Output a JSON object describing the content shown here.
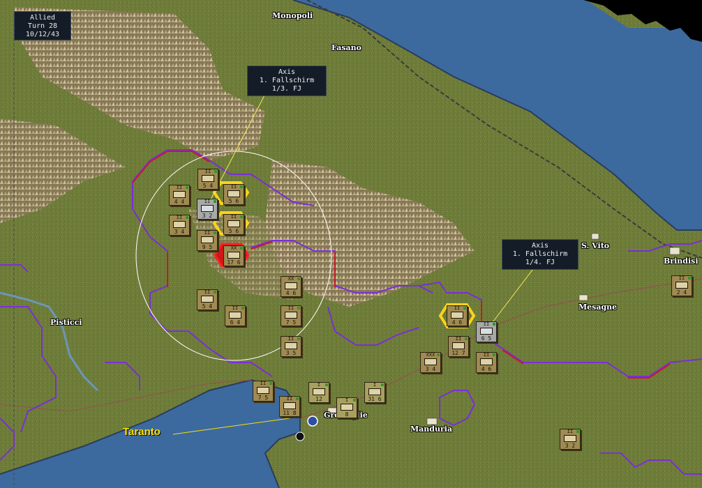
{
  "turn_box": {
    "side": "Allied",
    "turn": "Turn 28",
    "date": "10/12/43"
  },
  "tooltips": [
    {
      "side": "Axis",
      "division": "1. Fallschirm",
      "unit": "1/3. FJ"
    },
    {
      "side": "Axis",
      "division": "1. Fallschirm",
      "unit": "1/4. FJ"
    }
  ],
  "places": [
    {
      "name": "Monopoli"
    },
    {
      "name": "Fasano"
    },
    {
      "name": "Pisticci"
    },
    {
      "name": "S. Vito"
    },
    {
      "name": "Brindisi"
    },
    {
      "name": "Mesagne"
    },
    {
      "name": "Manduria"
    },
    {
      "name": "Grottaglie"
    }
  ],
  "highlight_city": {
    "name": "Taranto",
    "color": "#ffe000"
  },
  "colors": {
    "sea": "#3c6a9e",
    "land": "#6f7d3a",
    "axis_border": "#7a2fd6",
    "frontline": "#c21c2a",
    "selected_hex": "#ffd21c",
    "attack_hex": "#ff2020"
  },
  "units": [
    {
      "id": "u1",
      "size": "II",
      "type": "infantry",
      "val": "5 4",
      "side": "allied"
    },
    {
      "id": "u2",
      "size": "II",
      "type": "infantry",
      "val": "4 4",
      "side": "allied"
    },
    {
      "id": "u3",
      "size": "II",
      "type": "infantry",
      "val": "3 2",
      "side": "axis"
    },
    {
      "id": "u4",
      "size": "II",
      "type": "infantry",
      "val": "3 4",
      "side": "allied"
    },
    {
      "id": "u5",
      "size": "II",
      "type": "infantry",
      "val": "5 6",
      "side": "allied"
    },
    {
      "id": "u6",
      "size": "II",
      "type": "infantry",
      "val": "5 6",
      "side": "allied"
    },
    {
      "id": "u7",
      "size": "II",
      "type": "armor",
      "val": "9 5",
      "side": "allied"
    },
    {
      "id": "u8",
      "size": "XX",
      "type": "HQ",
      "val": "17 6",
      "side": "allied"
    },
    {
      "id": "u9",
      "size": "XX",
      "type": "HQ",
      "val": "4 6",
      "side": "allied"
    },
    {
      "id": "u10",
      "size": "II",
      "type": "recon",
      "val": "5 4",
      "side": "allied"
    },
    {
      "id": "u11",
      "size": "II",
      "type": "recon",
      "val": "6 4",
      "side": "allied"
    },
    {
      "id": "u12",
      "size": "II",
      "type": "recon",
      "val": "7 5",
      "side": "allied"
    },
    {
      "id": "u13",
      "size": "II",
      "type": "engineer",
      "val": "3 5",
      "side": "allied"
    },
    {
      "id": "u14",
      "size": "II",
      "type": "armor",
      "val": "4 6",
      "side": "allied"
    },
    {
      "id": "u15",
      "size": "II",
      "type": "infantry",
      "val": "6 5",
      "side": "axis"
    },
    {
      "id": "u16",
      "size": "II",
      "type": "armor",
      "val": "12 7",
      "side": "allied"
    },
    {
      "id": "u17",
      "size": "XXX",
      "type": "HQ",
      "val": "3 4",
      "side": "allied"
    },
    {
      "id": "u18",
      "size": "II",
      "type": "armor",
      "val": "4 6",
      "side": "allied"
    },
    {
      "id": "u19",
      "size": "II",
      "type": "infantry",
      "val": "2 4",
      "side": "allied"
    },
    {
      "id": "u20",
      "size": "II",
      "type": "recon",
      "val": "7 5",
      "side": "allied"
    },
    {
      "id": "u21",
      "size": "II",
      "type": "armor",
      "val": "11 8",
      "side": "allied"
    },
    {
      "id": "u22",
      "size": "I",
      "type": "air",
      "val": "12",
      "side": "allied"
    },
    {
      "id": "u23",
      "size": "I",
      "type": "air",
      "val": "31 6",
      "side": "allied"
    },
    {
      "id": "u24",
      "size": "I",
      "type": "air",
      "val": "8",
      "side": "allied"
    },
    {
      "id": "u25",
      "size": "II",
      "type": "mountain",
      "val": "3 2",
      "side": "allied"
    }
  ]
}
